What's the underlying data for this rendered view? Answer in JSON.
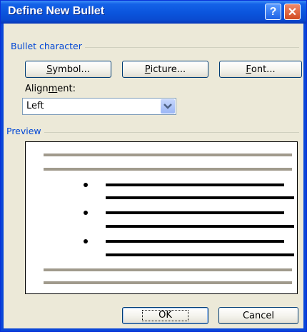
{
  "window": {
    "title": "Define New Bullet",
    "help_glyph": "?",
    "close_glyph": "✕"
  },
  "bullet_character": {
    "group_label": "Bullet character",
    "symbol_button": {
      "pre": "",
      "mnemonic": "S",
      "post": "ymbol..."
    },
    "picture_button": {
      "pre": "",
      "mnemonic": "P",
      "post": "icture..."
    },
    "font_button": {
      "pre": "",
      "mnemonic": "F",
      "post": "ont..."
    },
    "alignment_label": {
      "pre": "Align",
      "mnemonic": "m",
      "post": "ent:"
    },
    "alignment_value": "Left"
  },
  "preview": {
    "group_label": "Preview",
    "bullet_glyph": "•",
    "bullet_count": 3
  },
  "footer": {
    "ok_label": "OK",
    "cancel_label": "Cancel"
  },
  "colors": {
    "titlebar": "#0a54dc",
    "group_label": "#0046d5",
    "dialog_face": "#ece9d8",
    "preview_gray_line": "#a09a8c"
  }
}
